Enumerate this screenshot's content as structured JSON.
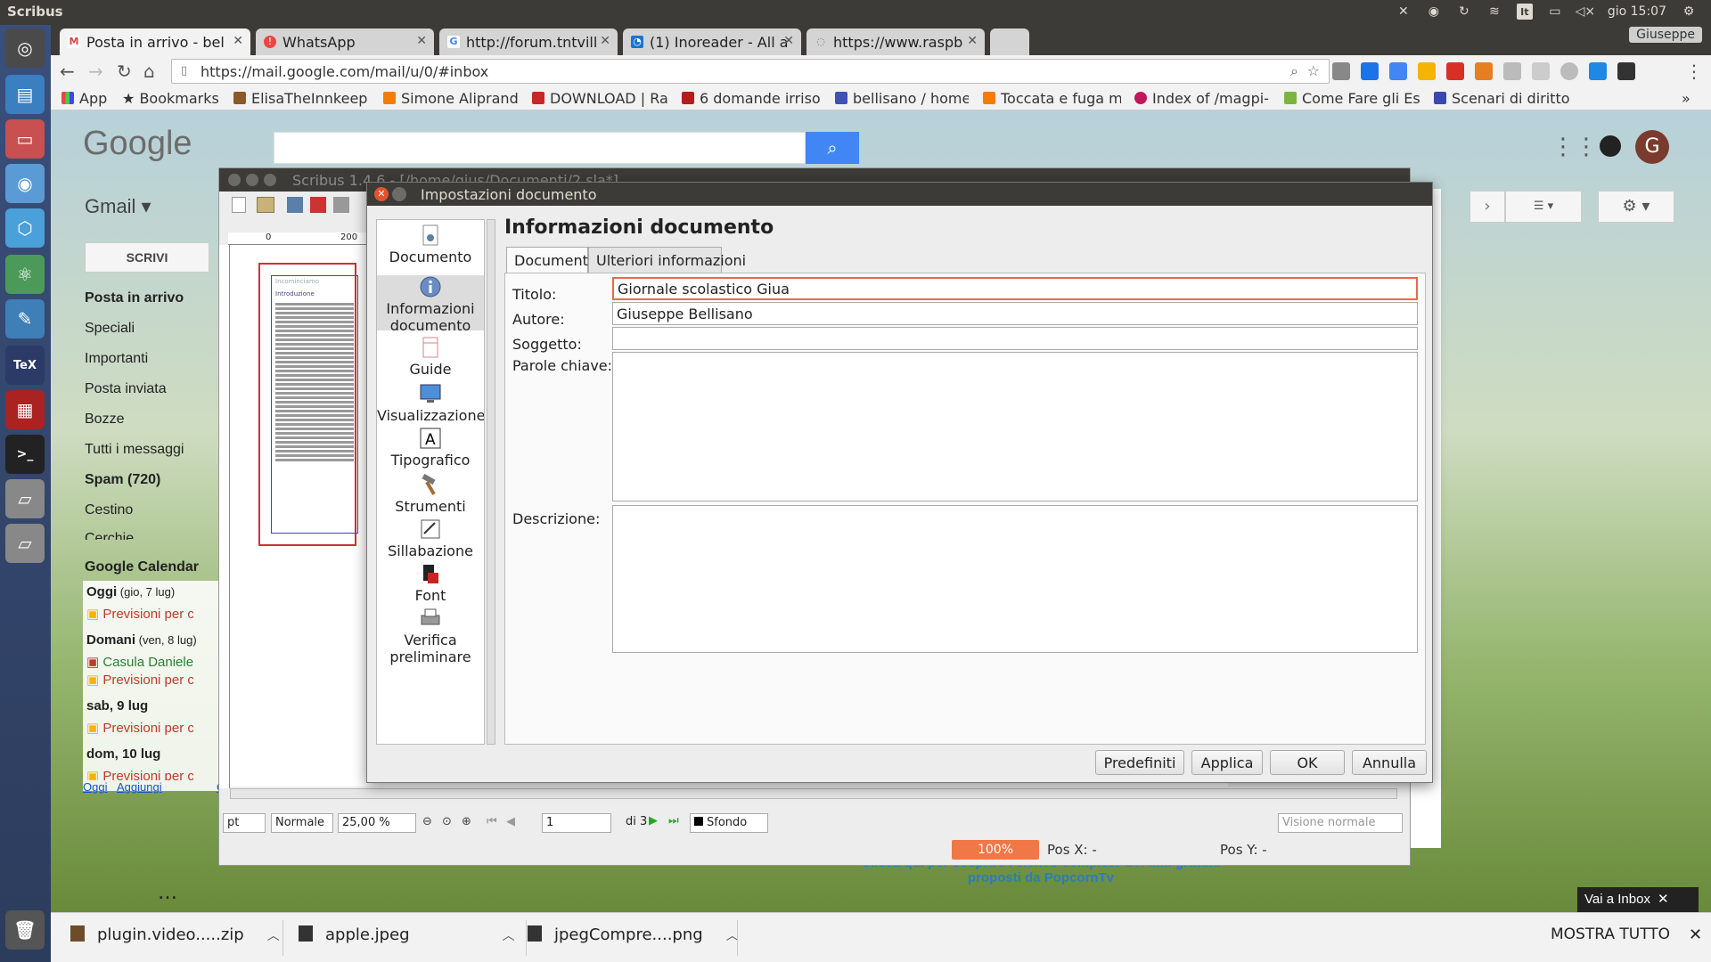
{
  "topbar": {
    "app_name": "Scribus",
    "keyboard": "It",
    "clock": "gio 15:07",
    "user": "Giuseppe"
  },
  "chrome": {
    "tabs": [
      {
        "title": "Posta in arrivo - bel",
        "icon": "gmail-icon"
      },
      {
        "title": "WhatsApp",
        "icon": "whatsapp-icon"
      },
      {
        "title": "http://forum.tntvill",
        "icon": "google-icon"
      },
      {
        "title": "(1) Inoreader - All a",
        "icon": "inoreader-icon"
      },
      {
        "title": "https://www.raspb",
        "icon": "loading-icon"
      }
    ],
    "url": "https://mail.google.com/mail/u/0/#inbox",
    "bookmarks": [
      "App",
      "Bookmarks",
      "ElisaTheInnkeep",
      "Simone Aliprand",
      "DOWNLOAD | Ra",
      "6 domande irriso",
      "bellisano / home",
      "Toccata e fuga m",
      "Index of /magpi-",
      "Come Fare gli Es",
      "Scenari di diritto"
    ]
  },
  "gmail": {
    "logo": "Google",
    "app_label": "Gmail ▾",
    "compose": "SCRIVI",
    "folders": [
      "Posta in arrivo",
      "Speciali",
      "Importanti",
      "Posta inviata",
      "Bozze",
      "Tutti i messaggi",
      "Spam (720)",
      "Cestino",
      "Cerchie"
    ],
    "avatar_letter": "G",
    "calendar": {
      "title": "Google Calendar",
      "rows": [
        {
          "day": "Oggi",
          "date": " (gio, 7 lug)"
        },
        {
          "event": "Previsioni per cag"
        },
        {
          "day": "Domani",
          "date": " (ven, 8 lug)"
        },
        {
          "event": "Casula Daniele - i"
        },
        {
          "event": "Previsioni per cag"
        },
        {
          "day": "sab, 9 lug",
          "date": ""
        },
        {
          "event": "Previsioni per cag"
        },
        {
          "day": "dom, 10 lug",
          "date": ""
        },
        {
          "event": "Previsioni per cag"
        }
      ],
      "links": [
        "Oggi",
        "Aggiungi",
        "Op"
      ]
    },
    "popcorn_text": "Clicca qui per scoprire l'elenco completo dei film gratuiti proposti da PopcornTv",
    "vai_inbox": "Vai a Inbox"
  },
  "scribus": {
    "title": "Scribus 1.4.6 - [/home/gius/Documenti/2.sla*]",
    "ruler_marks": [
      "0",
      "200"
    ],
    "status": {
      "unit": "pt",
      "mode": "Normale",
      "zoom": "25,00 %",
      "page": "1",
      "page_of": "di 3",
      "layer": "Sfondo",
      "view": "Visione normale",
      "zoom_pill": "100%",
      "pos_x": "Pos X:  -",
      "pos_y": "Pos Y:  -"
    },
    "page_text": {
      "heading1": "Incominciamo",
      "heading2": "Introduzione"
    }
  },
  "dialog": {
    "title": "Impostazioni documento",
    "heading": "Informazioni documento",
    "tabs": [
      "Documento",
      "Ulteriori informazioni"
    ],
    "sidebar": [
      {
        "label": "Documento",
        "icon": "document-icon"
      },
      {
        "label": "Informazioni documento",
        "icon": "info-icon"
      },
      {
        "label": "Guide",
        "icon": "guides-icon"
      },
      {
        "label": "Visualizzazione",
        "icon": "display-icon"
      },
      {
        "label": "Tipografico",
        "icon": "typography-icon"
      },
      {
        "label": "Strumenti",
        "icon": "hammer-icon"
      },
      {
        "label": "Sillabazione",
        "icon": "hyphenation-icon"
      },
      {
        "label": "Font",
        "icon": "font-icon"
      },
      {
        "label": "Verifica preliminare",
        "icon": "preflight-icon"
      }
    ],
    "fields": {
      "titolo_label": "Titolo:",
      "titolo_value": "Giornale scolastico Giua",
      "autore_label": "Autore:",
      "autore_value": "Giuseppe Bellisano",
      "soggetto_label": "Soggetto:",
      "soggetto_value": "",
      "parole_label": "Parole chiave:",
      "descrizione_label": "Descrizione:"
    },
    "buttons": {
      "defaults": "Predefiniti",
      "apply": "Applica",
      "ok": "OK",
      "cancel": "Annulla"
    }
  },
  "downloads": {
    "items": [
      "plugin.video.....zip",
      "apple.jpeg",
      "jpegCompre....png"
    ],
    "show_all": "MOSTRA TUTTO"
  },
  "colors": {
    "accent_orange": "#e86c44",
    "ubuntu_bar": "#3c3b37",
    "google_blue": "#4285f4"
  }
}
